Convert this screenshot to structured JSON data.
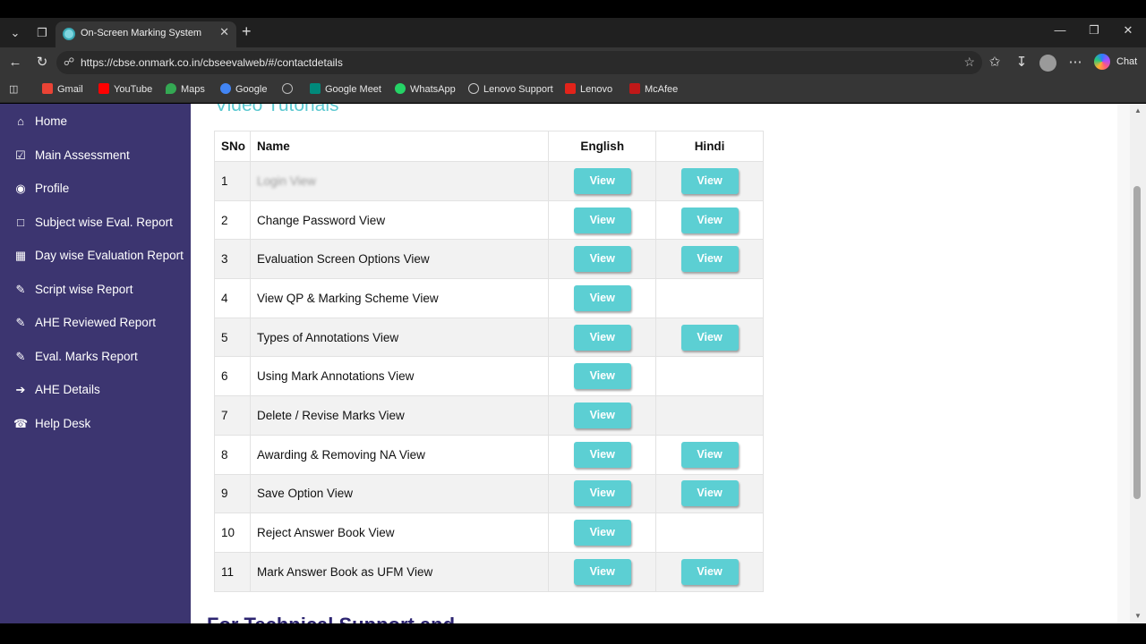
{
  "browser": {
    "tab_title": "On-Screen Marking System",
    "url": "https://cbse.onmark.co.in/cbseevalweb/#/contactdetails",
    "chat_label": "Chat",
    "bookmarks": [
      {
        "label": "Gmail",
        "color": "#ea4335"
      },
      {
        "label": "YouTube",
        "color": "#ff0000"
      },
      {
        "label": "Maps",
        "color": "#34a853"
      },
      {
        "label": "Google",
        "color": "#4285f4"
      },
      {
        "label": "",
        "color": "#bbbbbb"
      },
      {
        "label": "Google Meet",
        "color": "#00897b"
      },
      {
        "label": "WhatsApp",
        "color": "#25d366"
      },
      {
        "label": "Lenovo Support",
        "color": "#cccccc"
      },
      {
        "label": "Lenovo",
        "color": "#e2231a"
      },
      {
        "label": "McAfee",
        "color": "#c01818"
      }
    ]
  },
  "sidebar": {
    "items": [
      {
        "label": "Home",
        "icon": "home-icon"
      },
      {
        "label": "Main Assessment",
        "icon": "check-square-icon"
      },
      {
        "label": "Profile",
        "icon": "user-circle-icon"
      },
      {
        "label": "Subject wise Eval. Report",
        "icon": "file-icon"
      },
      {
        "label": "Day wise Evaluation Report",
        "icon": "calendar-icon"
      },
      {
        "label": "Script wise Report",
        "icon": "edit-icon"
      },
      {
        "label": "AHE Reviewed Report",
        "icon": "edit-icon"
      },
      {
        "label": "Eval. Marks Report",
        "icon": "edit-icon"
      },
      {
        "label": "AHE Details",
        "icon": "arrow-circle-right-icon"
      },
      {
        "label": "Help Desk",
        "icon": "phone-icon"
      }
    ]
  },
  "main": {
    "heading": "Video Tutorials",
    "next_heading": "For Technical Support and",
    "table": {
      "headers": {
        "sno": "SNo",
        "name": "Name",
        "english": "English",
        "hindi": "Hindi"
      },
      "button_label": "View",
      "rows": [
        {
          "sno": "1",
          "name": "Login View",
          "english": true,
          "hindi": true,
          "blurred": true
        },
        {
          "sno": "2",
          "name": "Change Password View",
          "english": true,
          "hindi": true
        },
        {
          "sno": "3",
          "name": "Evaluation Screen Options View",
          "english": true,
          "hindi": true
        },
        {
          "sno": "4",
          "name": "View QP & Marking Scheme View",
          "english": true,
          "hindi": false
        },
        {
          "sno": "5",
          "name": "Types of Annotations View",
          "english": true,
          "hindi": true
        },
        {
          "sno": "6",
          "name": "Using Mark Annotations View",
          "english": true,
          "hindi": false
        },
        {
          "sno": "7",
          "name": "Delete / Revise Marks View",
          "english": true,
          "hindi": false
        },
        {
          "sno": "8",
          "name": "Awarding & Removing NA View",
          "english": true,
          "hindi": true
        },
        {
          "sno": "9",
          "name": "Save Option View",
          "english": true,
          "hindi": true
        },
        {
          "sno": "10",
          "name": "Reject Answer Book View",
          "english": true,
          "hindi": false
        },
        {
          "sno": "11",
          "name": "Mark Answer Book as UFM View",
          "english": true,
          "hindi": true
        }
      ]
    }
  }
}
